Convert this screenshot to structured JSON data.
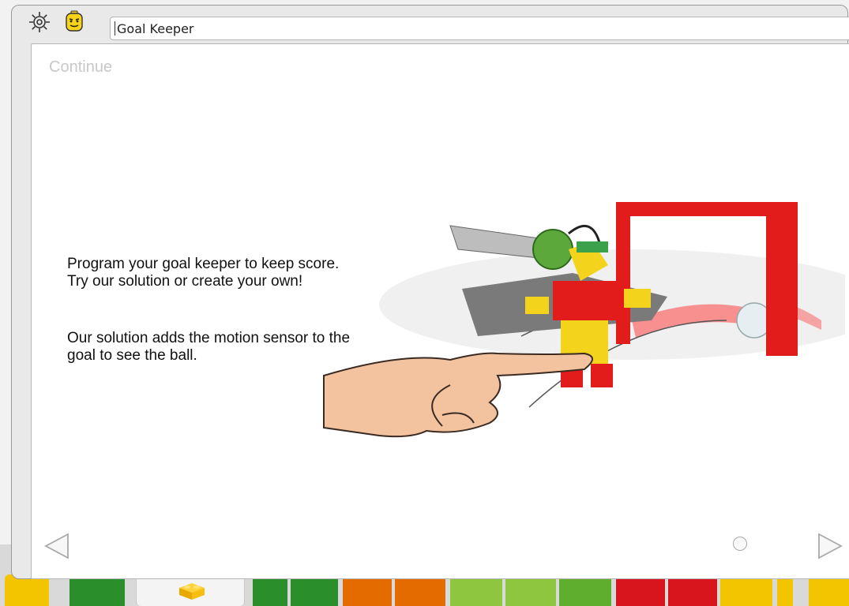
{
  "header": {
    "settings_icon": "gear-icon",
    "face_icon": "minifig-face-icon",
    "title": "Goal Keeper"
  },
  "content": {
    "section_label": "Continue",
    "paragraph_1": "Program your goal keeper to keep score. Try our solution or create your own!",
    "paragraph_2": "Our solution adds the motion sensor to the goal to see the ball.",
    "illustration": "goal-keeper-model-with-hand-illustration"
  },
  "navigation": {
    "prev_icon": "triangle-left-icon",
    "next_icon": "triangle-right-icon",
    "page_indicator": "circle-dot-icon"
  },
  "palette": {
    "tab_icon": "lego-brick-icon",
    "block_colors": [
      "#f2c500",
      "#2a8f2a",
      "#e36b00",
      "#8fc63f",
      "#d8141c"
    ]
  }
}
